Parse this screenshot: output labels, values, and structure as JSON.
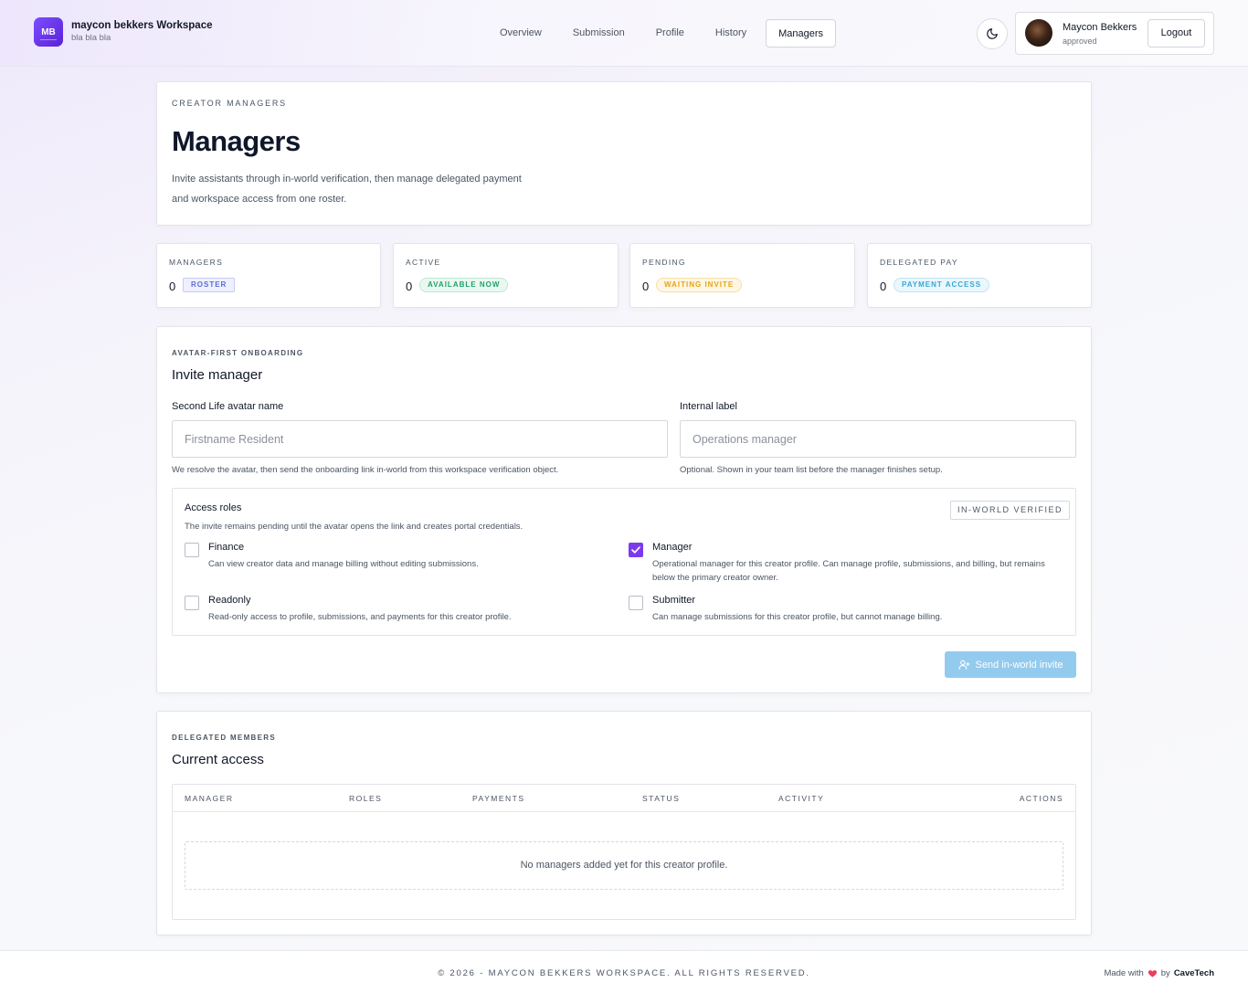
{
  "header": {
    "logo_initials": "MB",
    "workspace_name": "maycon bekkers Workspace",
    "workspace_tagline": "bla bla bla",
    "nav": [
      {
        "label": "Overview"
      },
      {
        "label": "Submission"
      },
      {
        "label": "Profile"
      },
      {
        "label": "History"
      },
      {
        "label": "Managers",
        "active": true
      }
    ],
    "user": {
      "name": "Maycon Bekkers",
      "status": "approved"
    },
    "logout_label": "Logout"
  },
  "intro": {
    "eyebrow": "CREATOR MANAGERS",
    "title": "Managers",
    "description_line1": "Invite assistants through in-world verification, then manage delegated payment",
    "description_line2": "and workspace access from one roster."
  },
  "stats": [
    {
      "label": "MANAGERS",
      "value": "0",
      "badge": "ROSTER",
      "badge_color": "#5b6bd6",
      "badge_bg": "#eef0fd",
      "badge_border": "#c7ccf4"
    },
    {
      "label": "ACTIVE",
      "value": "0",
      "badge": "AVAILABLE NOW",
      "badge_color": "#22a06b",
      "badge_bg": "#eaf8f1",
      "badge_border": "#bfe8d3"
    },
    {
      "label": "PENDING",
      "value": "0",
      "badge": "WAITING INVITE",
      "badge_color": "#e6a317",
      "badge_bg": "#fff6e3",
      "badge_border": "#f6dfa6"
    },
    {
      "label": "DELEGATED PAY",
      "value": "0",
      "badge": "PAYMENT ACCESS",
      "badge_color": "#3aa6d6",
      "badge_bg": "#eaf7fd",
      "badge_border": "#bfe6f5"
    }
  ],
  "invite": {
    "eyebrow": "AVATAR-FIRST ONBOARDING",
    "title": "Invite manager",
    "avatar_field": {
      "label": "Second Life avatar name",
      "placeholder": "Firstname Resident",
      "value": "",
      "hint": "We resolve the avatar, then send the onboarding link in-world from this workspace verification object."
    },
    "label_field": {
      "label": "Internal label",
      "placeholder": "Operations manager",
      "value": "",
      "hint": "Optional. Shown in your team list before the manager finishes setup."
    },
    "roles": {
      "title": "Access roles",
      "subtitle": "The invite remains pending until the avatar opens the link and creates portal credentials.",
      "tag": "IN-WORLD VERIFIED",
      "items": [
        {
          "name": "Finance",
          "description": "Can view creator data and manage billing without editing submissions.",
          "checked": false
        },
        {
          "name": "Manager",
          "description_line1": "Operational manager for this creator profile. Can manage profile, submissions, and billing, but remains",
          "description_line2": "below the primary creator owner.",
          "checked": true
        },
        {
          "name": "Readonly",
          "description": "Read-only access to profile, submissions, and payments for this creator profile.",
          "checked": false
        },
        {
          "name": "Submitter",
          "description": "Can manage submissions for this creator profile, but cannot manage billing.",
          "checked": false
        }
      ]
    },
    "send_label": "Send in-world invite"
  },
  "members": {
    "eyebrow": "DELEGATED MEMBERS",
    "title": "Current access",
    "columns": [
      "MANAGER",
      "ROLES",
      "PAYMENTS",
      "STATUS",
      "ACTIVITY",
      "ACTIONS"
    ],
    "empty_text": "No managers added yet for this creator profile."
  },
  "footer": {
    "copyright": "© 2026 - MAYCON BEKKERS WORKSPACE. ALL RIGHTS RESERVED.",
    "made_with": "Made with",
    "by": "by",
    "company": "CaveTech"
  }
}
